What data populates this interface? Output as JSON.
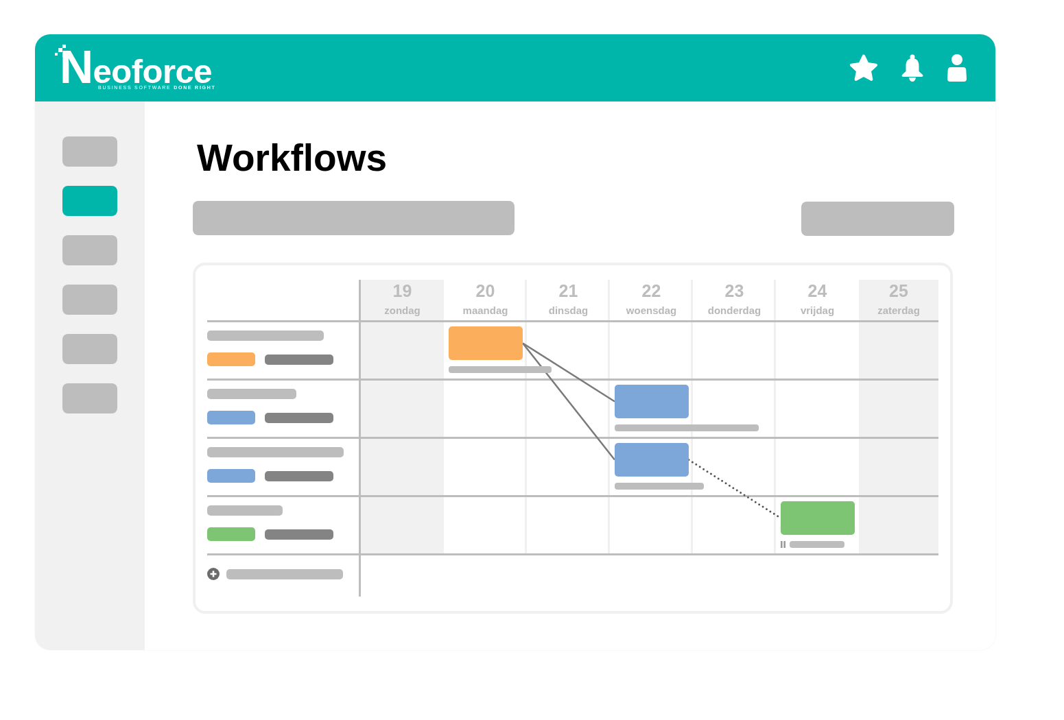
{
  "header": {
    "logo": {
      "name": "Neoforce",
      "tagline": "BUSINESS SOFTWARE **DONE RIGHT**"
    }
  },
  "sidebar": {
    "items": [
      {
        "selected": false
      },
      {
        "selected": true
      },
      {
        "selected": false
      },
      {
        "selected": false
      },
      {
        "selected": false
      },
      {
        "selected": false
      }
    ]
  },
  "page": {
    "title": "Workflows"
  },
  "gantt": {
    "days": [
      {
        "number": "19",
        "name": "zondag",
        "weekend": true
      },
      {
        "number": "20",
        "name": "maandag",
        "weekend": false
      },
      {
        "number": "21",
        "name": "dinsdag",
        "weekend": false
      },
      {
        "number": "22",
        "name": "woensdag",
        "weekend": false
      },
      {
        "number": "23",
        "name": "donderdag",
        "weekend": false
      },
      {
        "number": "24",
        "name": "vrijdag",
        "weekend": false
      },
      {
        "number": "25",
        "name": "zaterdag",
        "weekend": true
      }
    ],
    "rows": [
      {
        "color": "#fbaf5d",
        "paused": false
      },
      {
        "color": "#7da7d9",
        "paused": false
      },
      {
        "color": "#7da7d9",
        "paused": false
      },
      {
        "color": "#7dc473",
        "paused": true
      }
    ]
  }
}
